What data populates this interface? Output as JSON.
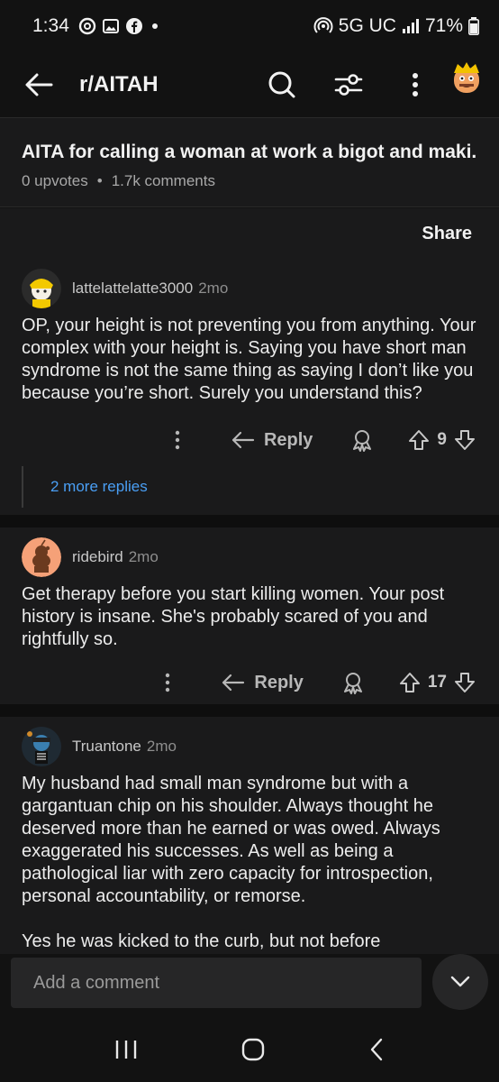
{
  "status": {
    "time": "1:34",
    "network": "5G UC",
    "battery": "71%"
  },
  "appbar": {
    "subreddit": "r/AITAH"
  },
  "post": {
    "title": "AITA for calling a woman at work a bigot and maki...",
    "upvotes": "0 upvotes",
    "separator": "•",
    "comments": "1.7k comments",
    "share_label": "Share"
  },
  "comments": [
    {
      "user": "lattelattelatte3000",
      "time": "2mo",
      "body": "OP, your height is not preventing you from anything. Your complex with your height is. Saying you have short man syndrome is not the same thing as saying I don’t like you because you’re short. Surely you understand this?",
      "reply_label": "Reply",
      "votes": "9",
      "more_replies": "2 more replies"
    },
    {
      "user": "ridebird",
      "time": "2mo",
      "body": "Get therapy before you start killing women. Your post history is insane. She's probably scared of you and rightfully so.",
      "reply_label": "Reply",
      "votes": "17"
    },
    {
      "user": "Truantone",
      "time": "2mo",
      "body": "My husband had small man syndrome but with a gargantuan chip on his shoulder. Always thought he deserved more than he earned or was owed.  Always exaggerated his successes. As well as being a pathological liar with zero capacity for introspection, personal accountability, or remorse.\n\nYes he was kicked to the curb, but not before"
    }
  ],
  "composer": {
    "placeholder": "Add a comment"
  },
  "colors": {
    "background": "#121212",
    "card": "#1a1a1b",
    "link": "#4a9ff5",
    "avatar_orange": "#f5a178"
  },
  "icons": [
    "back-arrow-icon",
    "search-icon",
    "filter-icon",
    "overflow-menu-icon",
    "snoo-avatar-icon",
    "reply-icon",
    "award-icon",
    "upvote-icon",
    "downvote-icon",
    "chevron-down-icon",
    "recents-icon",
    "home-icon",
    "back-icon"
  ]
}
